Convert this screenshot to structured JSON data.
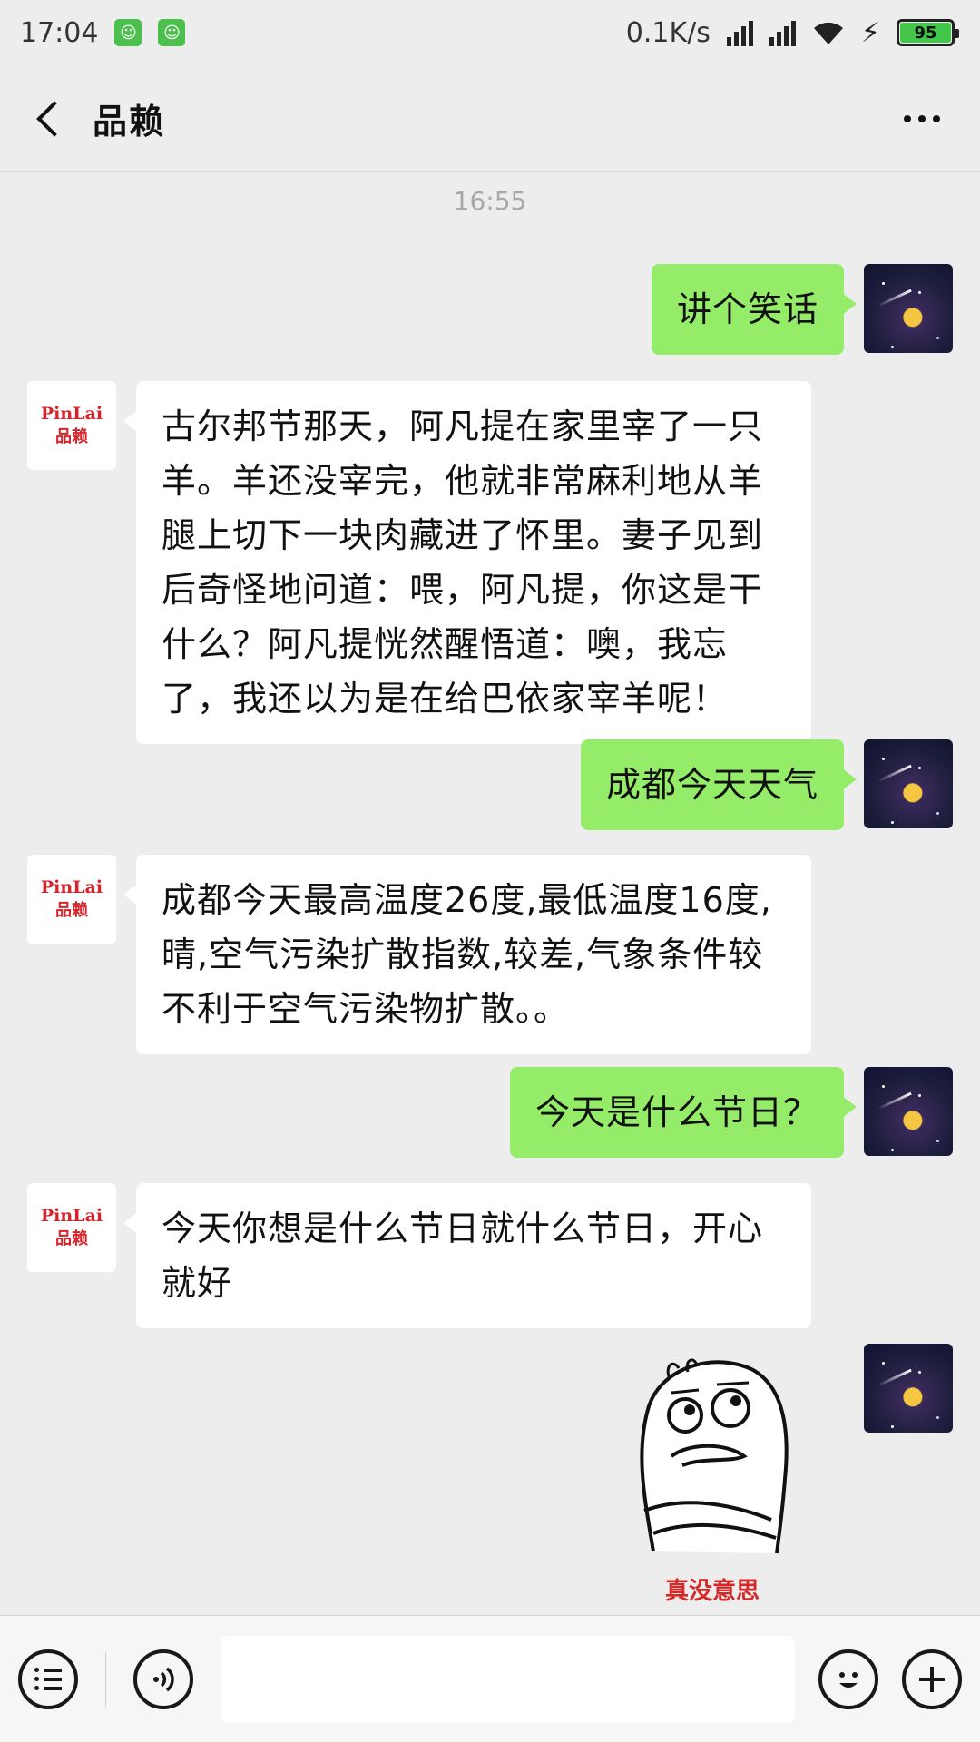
{
  "status_bar": {
    "time": "17:04",
    "network_speed": "0.1K/s",
    "battery": "95"
  },
  "header": {
    "title": "品赖"
  },
  "timestamp": "16:55",
  "bot_logo": {
    "en": "PinLai",
    "cn": "品赖"
  },
  "messages": [
    {
      "from": "me",
      "text": "讲个笑话"
    },
    {
      "from": "bot",
      "text": "古尔邦节那天，阿凡提在家里宰了一只羊。羊还没宰完，他就非常麻利地从羊腿上切下一块肉藏进了怀里。妻子见到后奇怪地问道：喂，阿凡提，你这是干什么？阿凡提恍然醒悟道：噢，我忘了，我还以为是在给巴依家宰羊呢！"
    },
    {
      "from": "me",
      "text": "成都今天天气"
    },
    {
      "from": "bot",
      "text": "成都今天最高温度26度,最低温度16度,晴,空气污染扩散指数,较差,气象条件较不利于空气污染物扩散。。"
    },
    {
      "from": "me",
      "text": "今天是什么节日？"
    },
    {
      "from": "bot",
      "text": "今天你想是什么节日就什么节日，开心就好"
    }
  ],
  "sticker": {
    "caption": "真没意思"
  },
  "input": {
    "placeholder": ""
  }
}
